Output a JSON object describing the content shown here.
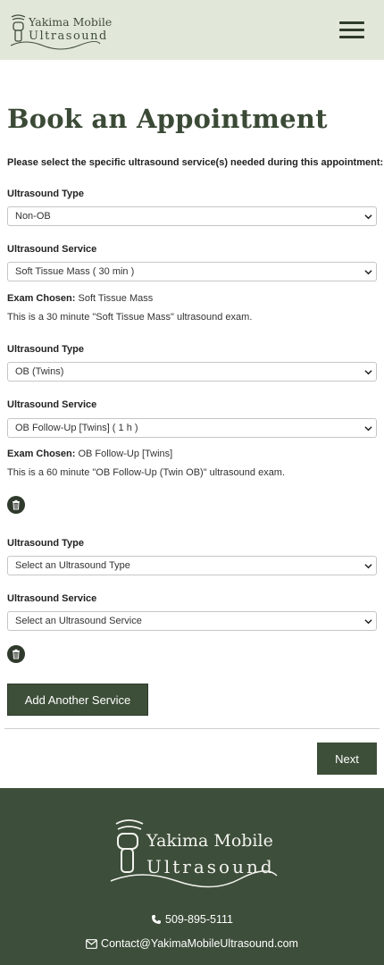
{
  "header": {
    "logo_line1": "Yakima Mobile",
    "logo_line2": "Ultrasound",
    "menu_icon": "hamburger-menu-icon"
  },
  "page": {
    "title": "Book an Appointment",
    "intro": "Please select the specific ultrasound service(s) needed during this appointment:"
  },
  "services": [
    {
      "type_label": "Ultrasound Type",
      "type_value": "Non-OB",
      "service_label": "Ultrasound Service",
      "service_value": "Soft Tissue Mass ( 30 min )",
      "exam_chosen_label": "Exam Chosen:",
      "exam_chosen_value": "Soft Tissue Mass",
      "description": "This is a 30 minute \"Soft Tissue Mass\" ultrasound exam."
    },
    {
      "type_label": "Ultrasound Type",
      "type_value": "OB (Twins)",
      "service_label": "Ultrasound Service",
      "service_value": "OB Follow-Up [Twins] ( 1 h )",
      "exam_chosen_label": "Exam Chosen:",
      "exam_chosen_value": "OB Follow-Up [Twins]",
      "description": "This is a 60 minute \"OB Follow-Up (Twin OB)\" ultrasound exam."
    },
    {
      "type_label": "Ultrasound Type",
      "type_value": "Select an Ultrasound Type",
      "service_label": "Ultrasound Service",
      "service_value": "Select an Ultrasound Service"
    }
  ],
  "buttons": {
    "add_service": "Add Another Service",
    "next": "Next"
  },
  "footer": {
    "logo_line1": "Yakima Mobile",
    "logo_line2": "Ultrasound",
    "phone": "509-895-5111",
    "email": "Contact@YakimaMobileUltrasound.com"
  },
  "colors": {
    "header_bg": "#e2e8d9",
    "brand_green": "#3e4f39",
    "footer_bg": "#3d4e3a"
  }
}
